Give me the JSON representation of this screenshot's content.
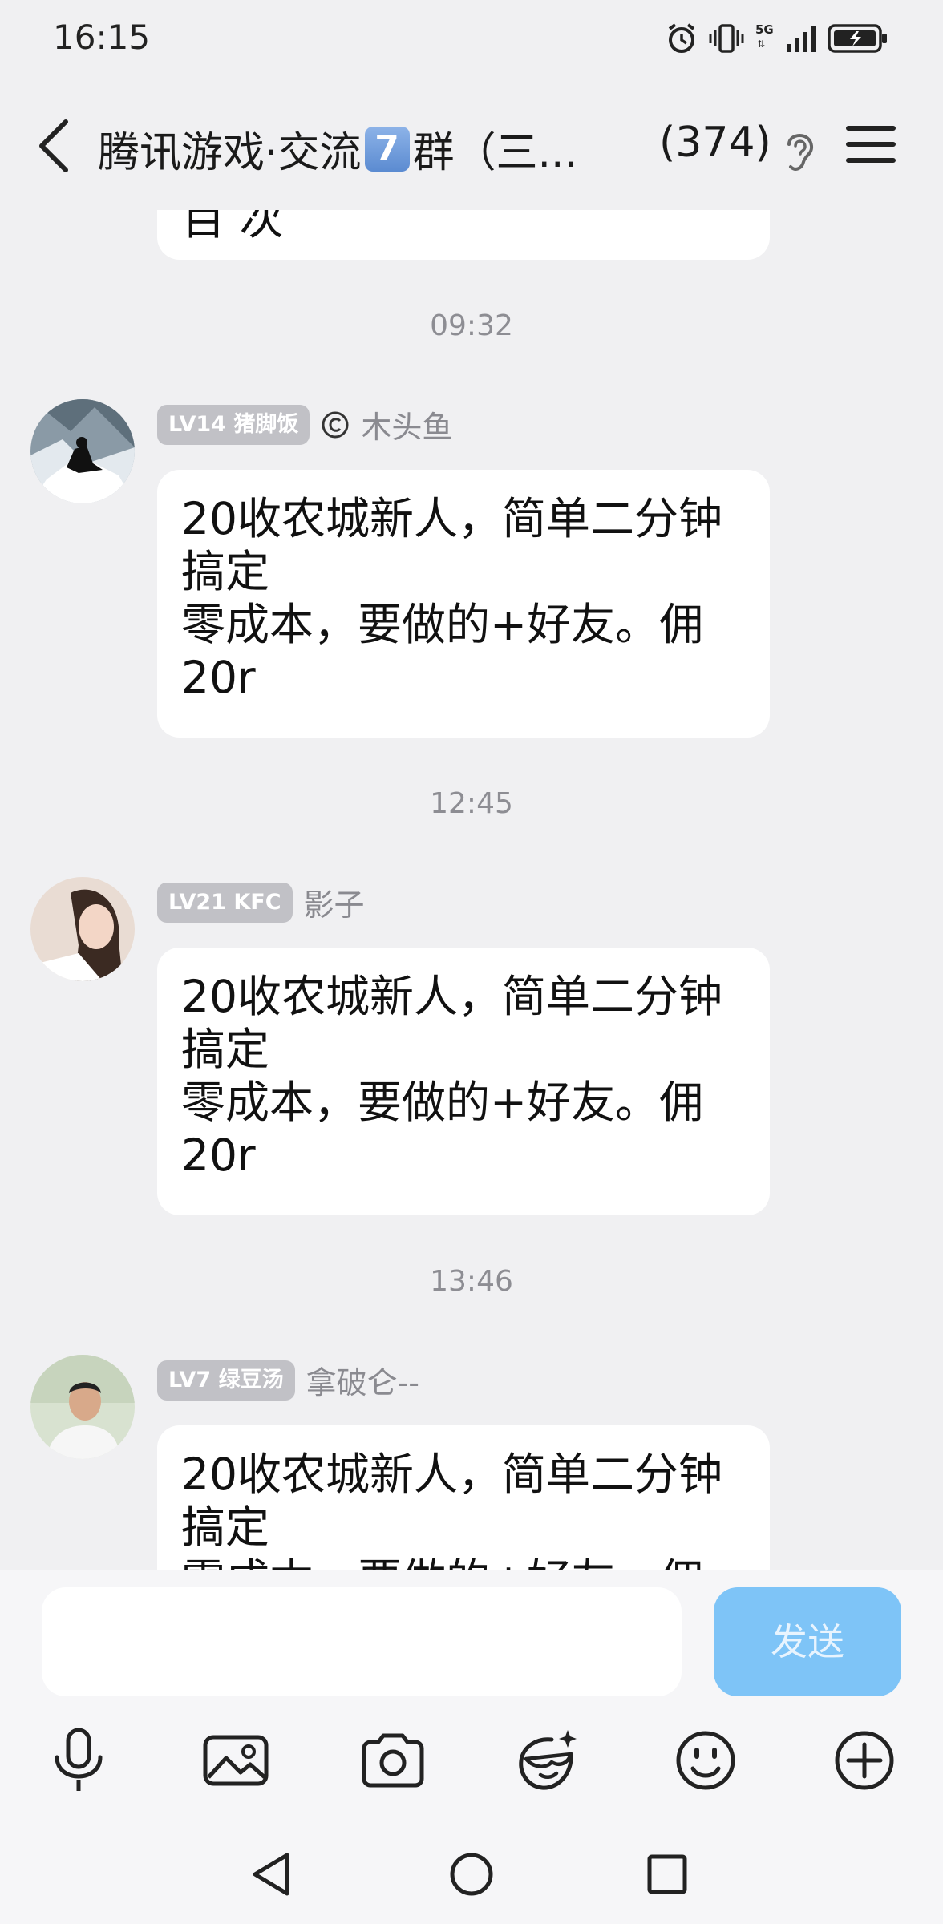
{
  "status_bar": {
    "time": "16:15",
    "network": "5G",
    "icons": [
      "alarm-icon",
      "vibrate-icon",
      "signal-icon",
      "battery-charging-icon"
    ]
  },
  "header": {
    "title_prefix": "腾讯游戏·交流",
    "title_badge": "7",
    "title_suffix": "群（三...",
    "member_count": "(374)",
    "icons": [
      "back-arrow-icon",
      "ear-icon",
      "menu-icon"
    ]
  },
  "chat": {
    "top_bubble_partial": "百  次",
    "messages": [
      {
        "timestamp": "09:32",
        "level": "LV14 猪脚饭",
        "sender": "木头鱼",
        "has_at_icon": true,
        "lines": [
          "20收农城新人，简单二分钟",
          "搞定",
          "零成本，要做的+好友。佣",
          "20r"
        ]
      },
      {
        "timestamp": "12:45",
        "level": "LV21 KFC",
        "sender": "影子",
        "has_at_icon": false,
        "lines": [
          "20收农城新人，简单二分钟",
          "搞定",
          "零成本，要做的+好友。佣",
          "20r"
        ]
      },
      {
        "timestamp": "13:46",
        "level": "LV7 绿豆汤",
        "sender": "拿破仑--",
        "has_at_icon": false,
        "lines": [
          "20收农城新人，简单二分钟",
          "搞定",
          "零成本，要做的+好友。佣"
        ]
      }
    ]
  },
  "composer": {
    "input_value": "",
    "send_label": "发送",
    "tools": [
      "microphone-icon",
      "image-icon",
      "camera-icon",
      "sticker-icon",
      "emoji-icon",
      "plus-icon"
    ]
  },
  "navigation": {
    "buttons": [
      "back-nav-icon",
      "home-nav-icon",
      "recents-nav-icon"
    ]
  },
  "colors": {
    "background": "#f0f0f2",
    "bubble": "#ffffff",
    "send_button": "#7ec4f7",
    "level_badge": "#c1c1c6",
    "title_badge": "#5b8bd1"
  }
}
